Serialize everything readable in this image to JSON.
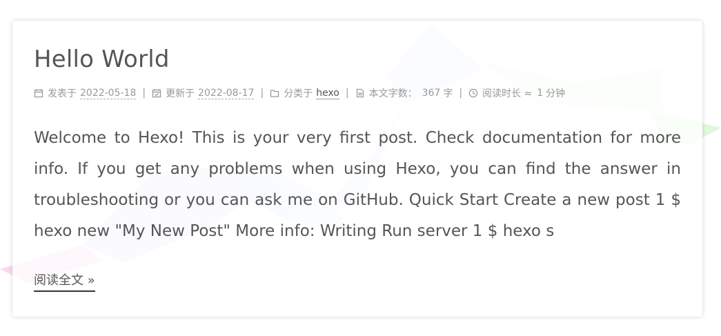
{
  "post": {
    "title": "Hello World",
    "meta": {
      "published_label": "发表于",
      "published_date": "2022-05-18",
      "separator": "|",
      "updated_label": "更新于",
      "updated_date": "2022-08-17",
      "category_label": "分类于",
      "category": "hexo",
      "wordcount_label": "本文字数：",
      "wordcount_value": "367",
      "wordcount_unit": "字",
      "readtime_label": "阅读时长 ≈",
      "readtime_value": "1",
      "readtime_unit": "分钟"
    },
    "excerpt": "Welcome to Hexo! This is your very first post. Check documentation for more info. If you get any problems when using Hexo, you can find the answer in troubleshooting or you can ask me on GitHub. Quick Start Create a new post 1 $ hexo new \"My New Post\" More info: Writing Run server 1 $ hexo s",
    "read_more": "阅读全文 »"
  },
  "icons": {
    "published": "calendar-icon",
    "updated": "calendar-check-icon",
    "category": "folder-icon",
    "wordcount": "file-word-icon",
    "readtime": "clock-icon"
  },
  "colors": {
    "title": "#555555",
    "meta": "#999999",
    "body": "#555555",
    "ribbon_blue": "#cfe3fb",
    "ribbon_green": "#dcf8d6",
    "ribbon_purple": "#d8d2fb",
    "ribbon_pink": "#f6c8ee"
  }
}
